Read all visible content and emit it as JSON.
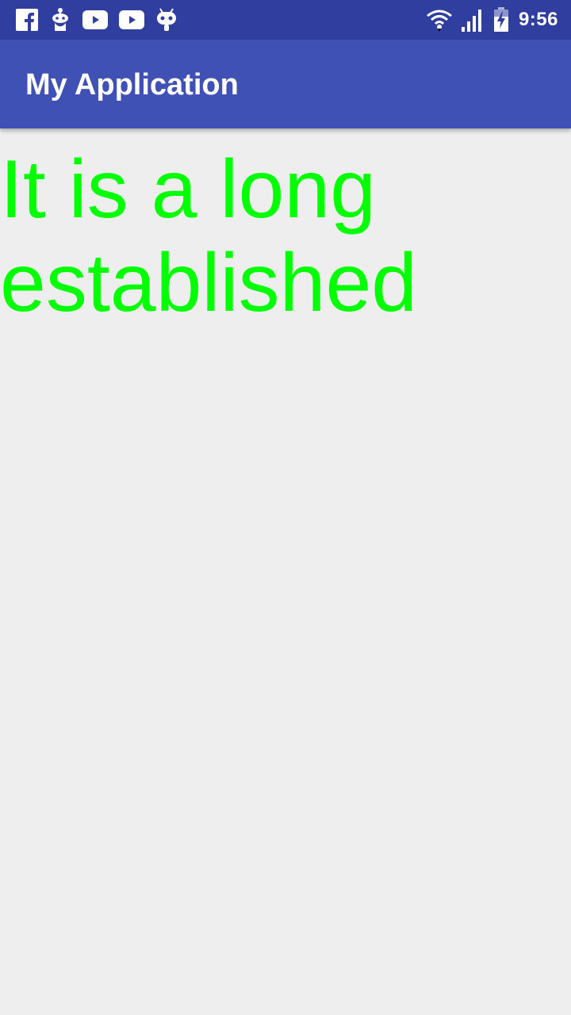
{
  "status_bar": {
    "time": "9:56",
    "notification_icons": [
      "facebook-icon",
      "reddit-icon",
      "youtube-icon",
      "youtube-icon",
      "cyanogen-icon"
    ],
    "system_icons": [
      "wifi-icon",
      "signal-icon",
      "battery-charging-icon"
    ]
  },
  "app_bar": {
    "title": "My Application"
  },
  "main": {
    "text": "It is a long established"
  },
  "colors": {
    "status_bar": "#303f9f",
    "app_bar": "#3f51b5",
    "background": "#eeeeee",
    "text": "#00ff00"
  }
}
